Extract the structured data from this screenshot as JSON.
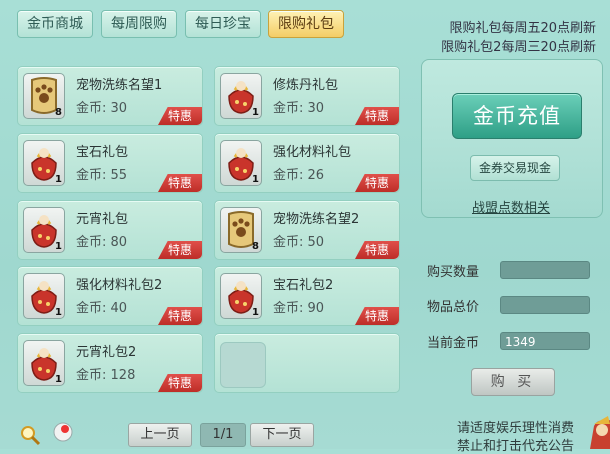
{
  "tabs": [
    "金币商城",
    "每周限购",
    "每日珍宝",
    "限购礼包"
  ],
  "notices": [
    "限购礼包每周五20点刷新",
    "限购礼包2每周三20点刷新"
  ],
  "price_prefix": "金币:",
  "badge": "特惠",
  "items": [
    {
      "name": "宠物洗练名望1",
      "price": "30",
      "qty": "8",
      "icon": "paw-badge-icon"
    },
    {
      "name": "修炼丹礼包",
      "price": "30",
      "qty": "1",
      "icon": "gift-bag-icon"
    },
    {
      "name": "宝石礼包",
      "price": "55",
      "qty": "1",
      "icon": "gift-bag-icon"
    },
    {
      "name": "强化材料礼包",
      "price": "26",
      "qty": "1",
      "icon": "gift-bag-icon"
    },
    {
      "name": "元宵礼包",
      "price": "80",
      "qty": "1",
      "icon": "gift-bag-icon"
    },
    {
      "name": "宠物洗练名望2",
      "price": "50",
      "qty": "8",
      "icon": "paw-badge-icon"
    },
    {
      "name": "强化材料礼包2",
      "price": "40",
      "qty": "1",
      "icon": "gift-bag-icon"
    },
    {
      "name": "宝石礼包2",
      "price": "90",
      "qty": "1",
      "icon": "gift-bag-icon"
    },
    {
      "name": "元宵礼包2",
      "price": "128",
      "qty": "1",
      "icon": "gift-bag-icon"
    }
  ],
  "right": {
    "recharge": "金币充值",
    "exchange": "金券交易现金",
    "alliance": "战盟点数相关",
    "buy_qty_label": "购买数量",
    "total_label": "物品总价",
    "coins_label": "当前金币",
    "buy_qty_value": "",
    "total_value": "",
    "coins_value": "1349",
    "buy_button": "购 买"
  },
  "pager": {
    "prev": "上一页",
    "indicator": "1/1",
    "next": "下一页"
  },
  "footer": [
    "请适度娱乐理性消费",
    "禁止和打击代充公告"
  ],
  "colors": {
    "accent": "#2e9f86",
    "badge": "#c9302a",
    "active_tab": "#f4cd66"
  }
}
